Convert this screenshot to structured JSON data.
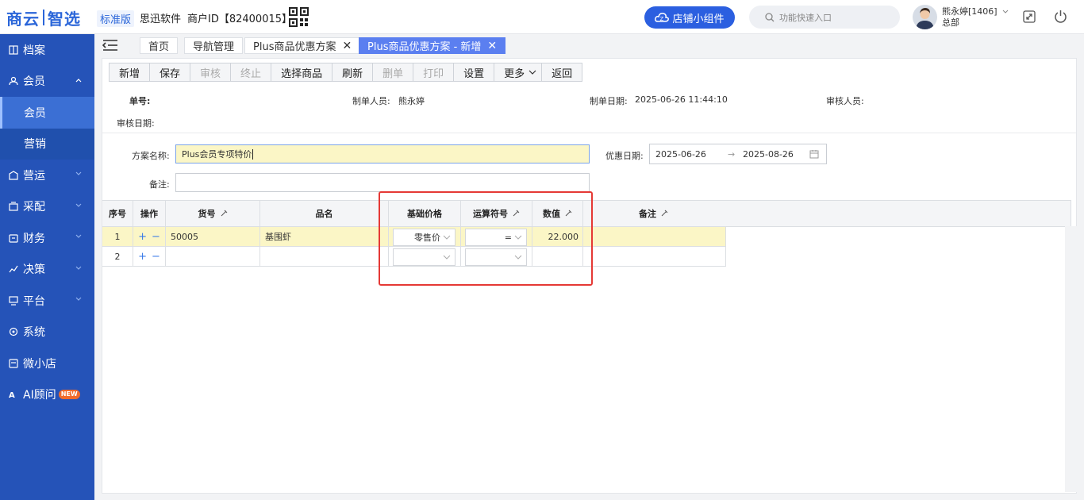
{
  "header": {
    "logo_part1": "商云",
    "logo_part2": "智选",
    "edition": "标准版",
    "company": "思迅软件",
    "merchant": "商户ID【82400015】",
    "shop_widget": "店铺小组件",
    "search_placeholder": "功能快速入口",
    "user_name": "熊永婷[1406]",
    "user_dept": "总部"
  },
  "sidebar": {
    "items": [
      {
        "label": "档案"
      },
      {
        "label": "会员"
      },
      {
        "label": "会员"
      },
      {
        "label": "营销"
      },
      {
        "label": "营运"
      },
      {
        "label": "采配"
      },
      {
        "label": "财务"
      },
      {
        "label": "决策"
      },
      {
        "label": "平台"
      },
      {
        "label": "系统"
      },
      {
        "label": "微小店"
      },
      {
        "label": "AI顾问"
      }
    ],
    "new_badge": "NEW"
  },
  "tabs": [
    {
      "label": "首页"
    },
    {
      "label": "导航管理"
    },
    {
      "label": "Plus商品优惠方案"
    },
    {
      "label": "Plus商品优惠方案 - 新增"
    }
  ],
  "toolbar": [
    "新增",
    "保存",
    "审核",
    "终止",
    "选择商品",
    "刷新",
    "删单",
    "打印",
    "设置",
    "更多",
    "返回"
  ],
  "meta": {
    "order_no_label": "单号:",
    "maker_label": "制单人员:",
    "maker_value": "熊永婷",
    "date_label": "制单日期:",
    "date_value": "2025-06-26 11:44:10",
    "auditor_label": "审核人员:",
    "audit_date_label": "审核日期:"
  },
  "form": {
    "scheme_label": "方案名称:",
    "scheme_value": "Plus会员专项特价",
    "remark_label": "备注:",
    "remark_value": "",
    "discount_date_label": "优惠日期:",
    "date_from": "2025-06-26",
    "date_to": "2025-08-26",
    "date_arrow": "→"
  },
  "grid": {
    "headers": [
      "序号",
      "操作",
      "货号",
      "品名",
      "基础价格",
      "运算符号",
      "数值",
      "备注"
    ],
    "rows": [
      {
        "no": "1",
        "code": "50005",
        "name": "基围虾",
        "base_price": "零售价",
        "operator": "=",
        "value": "22.000",
        "remark": ""
      },
      {
        "no": "2",
        "code": "",
        "name": "",
        "base_price": "",
        "operator": "",
        "value": "",
        "remark": ""
      }
    ],
    "row_ops": {
      "add": "+",
      "remove": "−"
    }
  },
  "colors": {
    "brand": "#2b66d9",
    "sidebar": "#2553b8",
    "highlight": "#fbf6c6",
    "annotation": "#e53935"
  }
}
